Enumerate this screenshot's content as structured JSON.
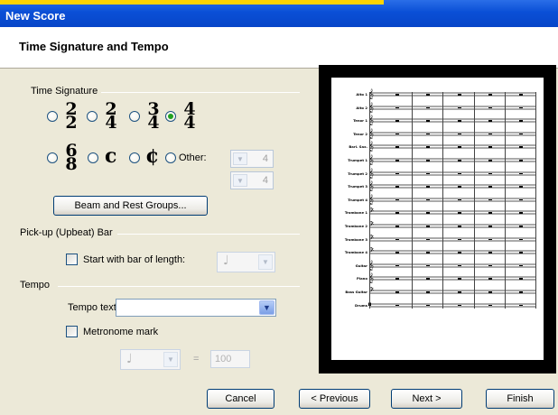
{
  "window": {
    "title": "New Score"
  },
  "page": {
    "heading": "Time Signature and Tempo"
  },
  "time_signature": {
    "group_label": "Time Signature",
    "options": [
      {
        "top": "2",
        "bottom": "2",
        "selected": false
      },
      {
        "top": "2",
        "bottom": "4",
        "selected": false
      },
      {
        "top": "3",
        "bottom": "4",
        "selected": false
      },
      {
        "top": "4",
        "bottom": "4",
        "selected": true
      },
      {
        "top": "6",
        "bottom": "8",
        "selected": false
      },
      {
        "symbol": "c",
        "selected": false
      },
      {
        "symbol": "¢",
        "selected": false
      }
    ],
    "other_label": "Other:",
    "other_top": "4",
    "other_bottom": "4",
    "beam_button": "Beam and Rest Groups..."
  },
  "pickup": {
    "group_label": "Pick-up (Upbeat) Bar",
    "checkbox_label": "Start with bar of length:",
    "checked": false,
    "length_icon": "quarter-note-icon"
  },
  "tempo": {
    "group_label": "Tempo",
    "tempo_text_label": "Tempo text:",
    "tempo_text_value": "",
    "metronome_label": "Metronome mark",
    "metronome_checked": false,
    "equals": "=",
    "bpm": "100",
    "note_icon": "quarter-note-icon"
  },
  "preview": {
    "staves": [
      {
        "label": "Alto 1",
        "clef": "treble"
      },
      {
        "label": "Alto 2",
        "clef": "treble"
      },
      {
        "label": "Tenor 1",
        "clef": "treble"
      },
      {
        "label": "Tenor 2",
        "clef": "treble"
      },
      {
        "label": "Bari. Sax.",
        "clef": "treble"
      },
      {
        "label": "Trumpet 1",
        "clef": "treble"
      },
      {
        "label": "Trumpet 2",
        "clef": "treble"
      },
      {
        "label": "Trumpet 3",
        "clef": "treble"
      },
      {
        "label": "Trumpet 4",
        "clef": "treble"
      },
      {
        "label": "Trombone 1",
        "clef": "bass"
      },
      {
        "label": "Trombone 2",
        "clef": "bass"
      },
      {
        "label": "Trombone 3",
        "clef": "bass"
      },
      {
        "label": "Trombone 4",
        "clef": "bass"
      },
      {
        "label": "Guitar",
        "clef": "treble"
      },
      {
        "label": "Piano",
        "clef": "grand"
      },
      {
        "label": "Bass Guitar",
        "clef": "bass"
      },
      {
        "label": "Drums",
        "clef": "percussion"
      }
    ],
    "bars": 5
  },
  "footer": {
    "cancel": "Cancel",
    "previous": "< Previous",
    "next": "Next >",
    "finish": "Finish"
  }
}
